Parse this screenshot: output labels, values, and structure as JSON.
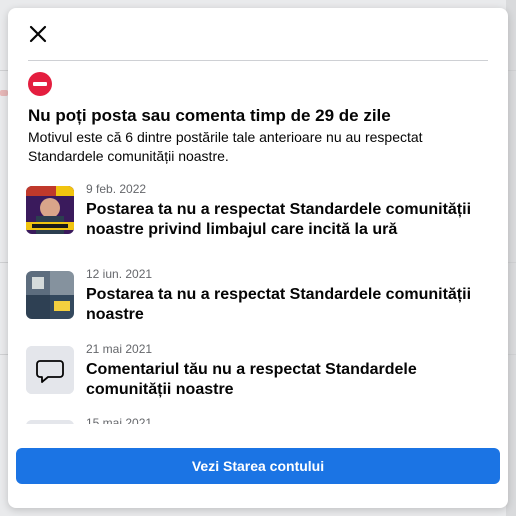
{
  "colors": {
    "accent": "#1b74e4",
    "stop_red": "#e41e3f",
    "secondary_text": "#65676b"
  },
  "dialog": {
    "close_icon": "close-icon",
    "status_icon": "no-entry-icon",
    "headline": "Nu poți posta sau comenta timp de 29 de zile",
    "reason": "Motivul este că 6 dintre postările tale anterioare nu au respectat Standardele comunității noastre.",
    "items": [
      {
        "thumb": "video-thumbnail",
        "date": "9 feb. 2022",
        "title": "Postarea ta nu a respectat Standardele comunității noastre privind limbajul care incită la ură"
      },
      {
        "thumb": "photo-thumbnail",
        "date": "12 iun. 2021",
        "title": "Postarea ta nu a respectat Standardele comunității noastre"
      },
      {
        "thumb": "comment-icon",
        "date": "21 mai 2021",
        "title": "Comentariul tău nu a respectat Standardele comunității noastre"
      },
      {
        "thumb": "comment-icon",
        "date": "15 mai 2021",
        "title": ""
      }
    ],
    "button_label": "Vezi Starea contului"
  }
}
